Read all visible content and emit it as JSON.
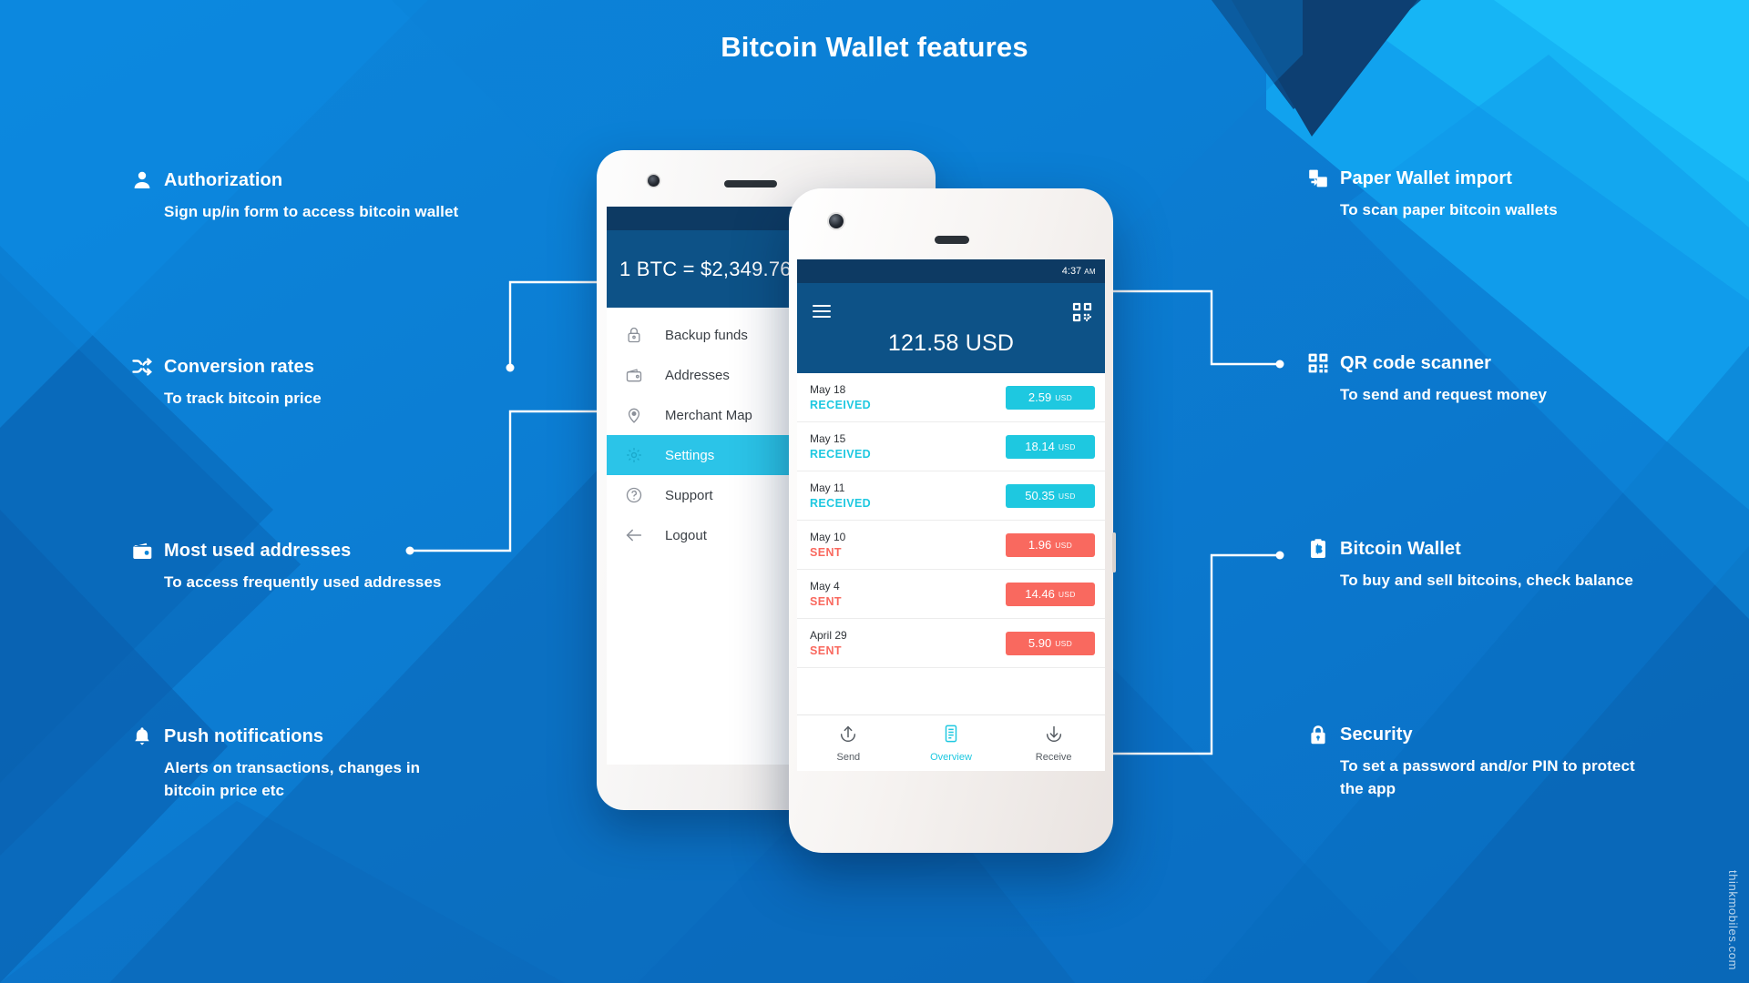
{
  "header": {
    "title": "Bitcoin Wallet features"
  },
  "watermark": "thinkmobiles.com",
  "colors": {
    "brand_blue": "#0a84d8",
    "deep_navy": "#0d3a63",
    "header_blue": "#0d5287",
    "cyan": "#1ec8e0",
    "coral": "#f9695f",
    "white": "#ffffff"
  },
  "features_left": [
    {
      "icon": "user-icon",
      "title": "Authorization",
      "desc": "Sign up/in form to access bitcoin wallet"
    },
    {
      "icon": "shuffle-icon",
      "title": "Conversion rates",
      "desc": "To track bitcoin price"
    },
    {
      "icon": "wallet-icon",
      "title": "Most used addresses",
      "desc": "To access frequently used addresses"
    },
    {
      "icon": "bell-icon",
      "title": "Push notifications",
      "desc": "Alerts on transactions, changes in bitcoin price etc"
    }
  ],
  "features_right": [
    {
      "icon": "paper-import-icon",
      "title": "Paper Wallet import",
      "desc": "To scan paper bitcoin wallets"
    },
    {
      "icon": "qr-code-icon",
      "title": "QR code scanner",
      "desc": "To send and request money"
    },
    {
      "icon": "clipboard-bitcoin-icon",
      "title": "Bitcoin Wallet",
      "desc": "To buy and sell bitcoins, check balance"
    },
    {
      "icon": "lock-icon",
      "title": "Security",
      "desc": "To set a password and/or PIN to protect the app"
    }
  ],
  "phone_back": {
    "rate_header": "1 BTC = $2,349.76",
    "menu": [
      {
        "icon": "lock-icon",
        "label": "Backup funds",
        "active": false
      },
      {
        "icon": "wallet-icon",
        "label": "Addresses",
        "active": false
      },
      {
        "icon": "map-pin-icon",
        "label": "Merchant Map",
        "active": false
      },
      {
        "icon": "gear-icon",
        "label": "Settings",
        "active": true
      },
      {
        "icon": "help-icon",
        "label": "Support",
        "active": false
      },
      {
        "icon": "arrow-left-icon",
        "label": "Logout",
        "active": false
      }
    ]
  },
  "phone_front": {
    "status_time": "4:37",
    "status_ampm": "AM",
    "balance": "121.58 USD",
    "transactions": [
      {
        "date": "May 18",
        "kind": "RECEIVED",
        "amount": "2.59",
        "currency": "USD",
        "type": "received"
      },
      {
        "date": "May 15",
        "kind": "RECEIVED",
        "amount": "18.14",
        "currency": "USD",
        "type": "received"
      },
      {
        "date": "May 11",
        "kind": "RECEIVED",
        "amount": "50.35",
        "currency": "USD",
        "type": "received"
      },
      {
        "date": "May 10",
        "kind": "SENT",
        "amount": "1.96",
        "currency": "USD",
        "type": "sent"
      },
      {
        "date": "May 4",
        "kind": "SENT",
        "amount": "14.46",
        "currency": "USD",
        "type": "sent"
      },
      {
        "date": "April 29",
        "kind": "SENT",
        "amount": "5.90",
        "currency": "USD",
        "type": "sent"
      }
    ],
    "nav": [
      {
        "icon": "arrow-up-circle-icon",
        "label": "Send",
        "active": false
      },
      {
        "icon": "list-icon",
        "label": "Overview",
        "active": true
      },
      {
        "icon": "arrow-down-circle-icon",
        "label": "Receive",
        "active": false
      }
    ]
  }
}
